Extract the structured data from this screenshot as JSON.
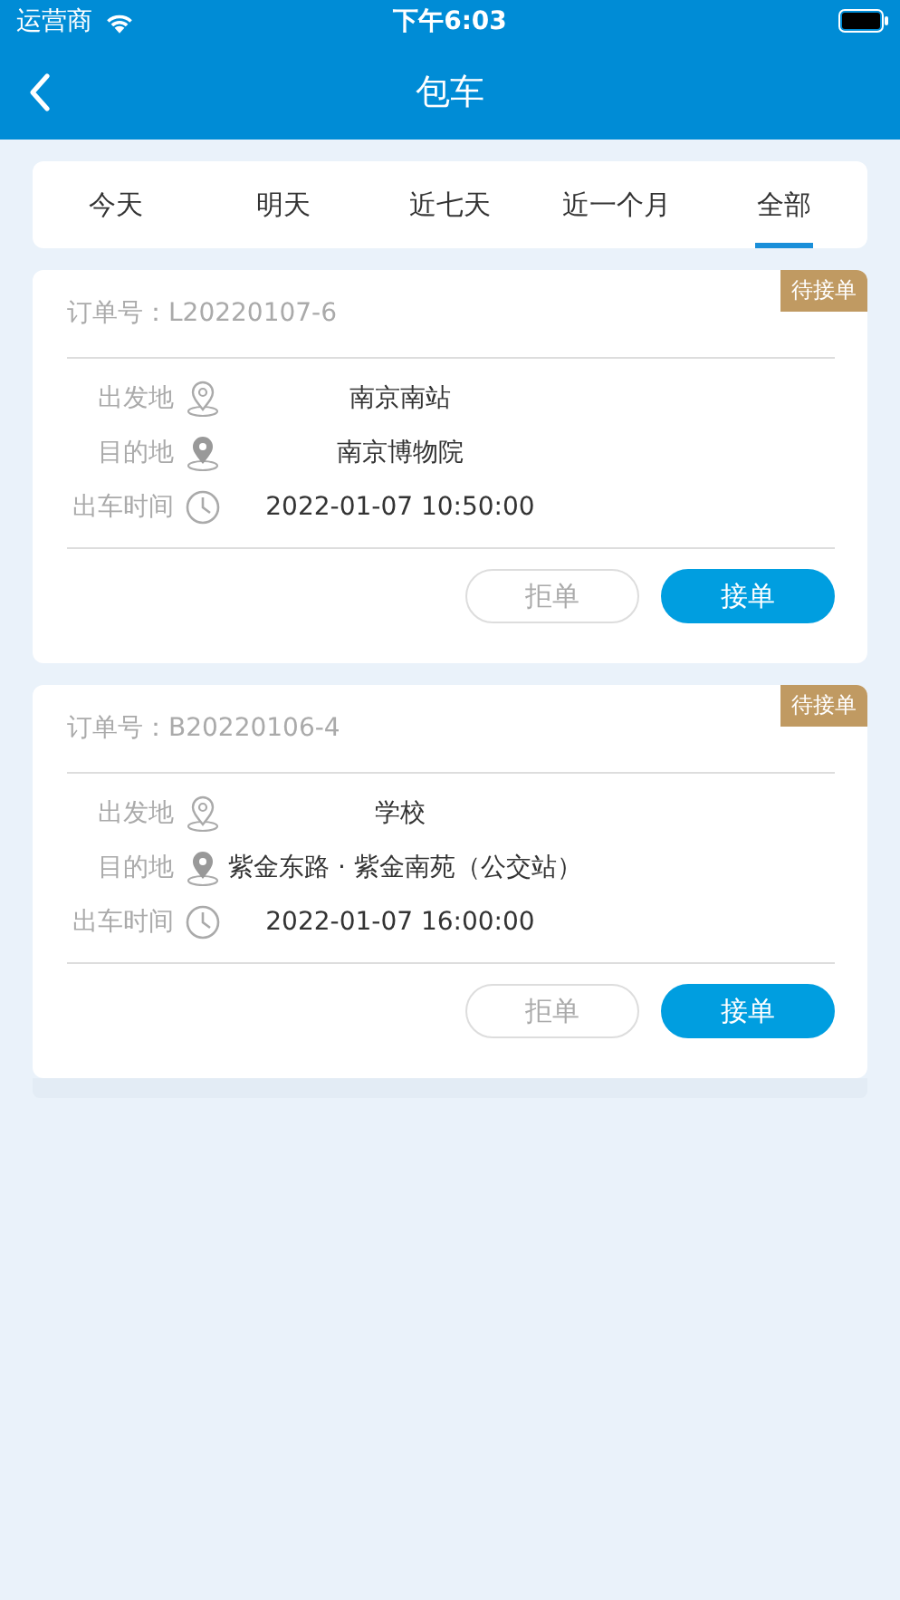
{
  "status_bar": {
    "carrier": "运营商",
    "time": "下午6:03"
  },
  "nav_bar": {
    "title": "包车"
  },
  "tabs": [
    {
      "label": "今天",
      "selected": false
    },
    {
      "label": "明天",
      "selected": false
    },
    {
      "label": "近七天",
      "selected": false
    },
    {
      "label": "近一个月",
      "selected": false
    },
    {
      "label": "全部",
      "selected": true
    }
  ],
  "orders": [
    {
      "order_label": "订单号：",
      "order_no": "L20220107-6",
      "status": "待接单",
      "fields": [
        {
          "kind": "origin",
          "label": "出发地",
          "value": "南京南站"
        },
        {
          "kind": "destination",
          "label": "目的地",
          "value": "南京博物院"
        },
        {
          "kind": "time",
          "label": "出车时间",
          "value": "2022-01-07 10:50:00"
        }
      ],
      "buttons": [
        {
          "kind": "reject",
          "label": "拒单"
        },
        {
          "kind": "accept",
          "label": "接单"
        }
      ]
    },
    {
      "order_label": "订单号：",
      "order_no": "B20220106-4",
      "status": "待接单",
      "fields": [
        {
          "kind": "origin",
          "label": "出发地",
          "value": "学校"
        },
        {
          "kind": "destination",
          "label": "目的地",
          "value": "紫金东路 · 紫金南苑（公交站）"
        },
        {
          "kind": "time",
          "label": "出车时间",
          "value": "2022-01-07 16:00:00"
        }
      ],
      "buttons": [
        {
          "kind": "reject",
          "label": "拒单"
        },
        {
          "kind": "accept",
          "label": "接单"
        }
      ]
    }
  ]
}
